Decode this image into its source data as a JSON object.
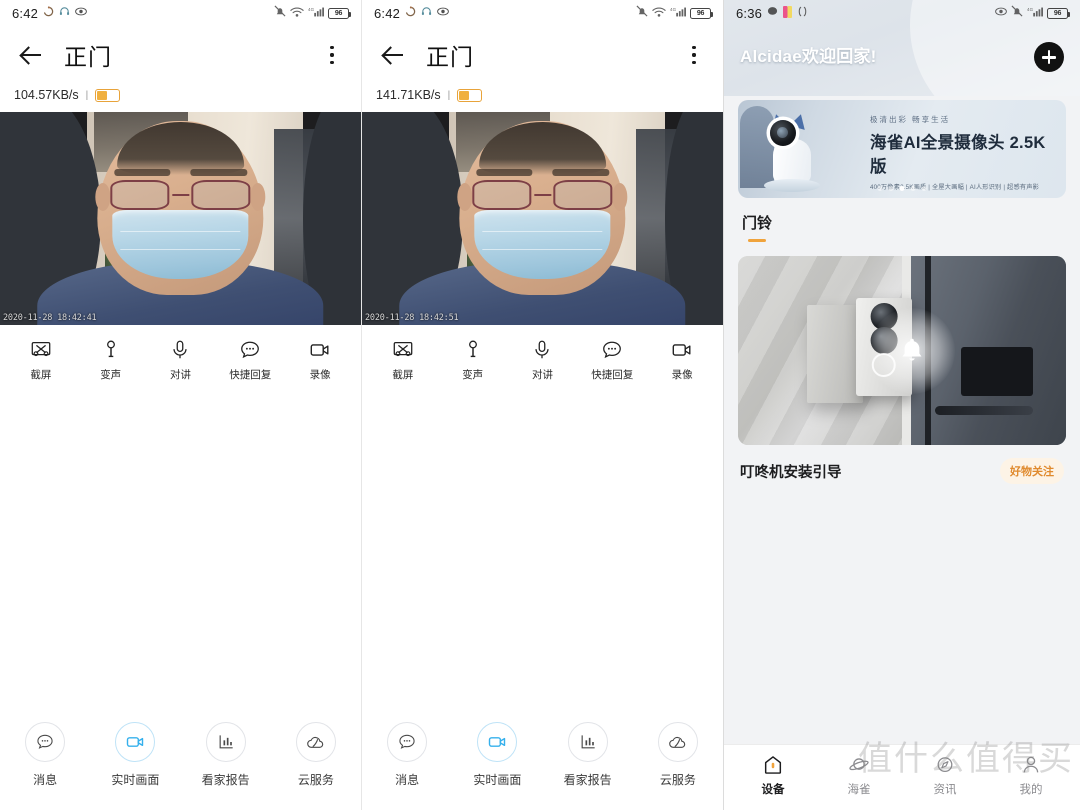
{
  "panels": [
    {
      "status": {
        "time": "6:42",
        "battery": "96",
        "icons": [
          "sync-icon",
          "headphones-icon",
          "eye-icon",
          "bell-off-icon",
          "wifi-icon",
          "signal-icon",
          "battery-icon"
        ]
      },
      "appbar": {
        "title": "正门",
        "back": "back-arrow-icon",
        "menu": "kebab-menu-icon"
      },
      "speed": {
        "value": "104.57KB/s",
        "separator": "|",
        "signal_badge": "signal-pill"
      },
      "video": {
        "timestamp": "2020-11-28 18:42:41"
      },
      "controls": [
        {
          "label": "截屏",
          "icon": "screenshot-icon"
        },
        {
          "label": "变声",
          "icon": "voice-changer-icon"
        },
        {
          "label": "对讲",
          "icon": "microphone-icon"
        },
        {
          "label": "快捷回复",
          "icon": "quick-reply-icon"
        },
        {
          "label": "录像",
          "icon": "record-video-icon"
        }
      ],
      "bottomnav": [
        {
          "label": "消息",
          "icon": "chat-bubble-icon",
          "active": false
        },
        {
          "label": "实时画面",
          "icon": "video-camera-icon",
          "active": true
        },
        {
          "label": "看家报告",
          "icon": "bar-chart-icon",
          "active": false
        },
        {
          "label": "云服务",
          "icon": "cloud-icon",
          "active": false
        }
      ]
    },
    {
      "status": {
        "time": "6:42",
        "battery": "96"
      },
      "appbar": {
        "title": "正门"
      },
      "speed": {
        "value": "141.71KB/s",
        "separator": "|"
      },
      "video": {
        "timestamp": "2020-11-28 18:42:51"
      },
      "controls": [
        {
          "label": "截屏",
          "icon": "screenshot-icon"
        },
        {
          "label": "变声",
          "icon": "voice-changer-icon"
        },
        {
          "label": "对讲",
          "icon": "microphone-icon"
        },
        {
          "label": "快捷回复",
          "icon": "quick-reply-icon"
        },
        {
          "label": "录像",
          "icon": "record-video-icon"
        }
      ],
      "bottomnav": [
        {
          "label": "消息",
          "icon": "chat-bubble-icon",
          "active": false
        },
        {
          "label": "实时画面",
          "icon": "video-camera-icon",
          "active": true
        },
        {
          "label": "看家报告",
          "icon": "bar-chart-icon",
          "active": false
        },
        {
          "label": "云服务",
          "icon": "cloud-icon",
          "active": false
        }
      ]
    }
  ],
  "home": {
    "status": {
      "time": "6:36",
      "battery": "96",
      "icons": [
        "chat-icon",
        "app-icon",
        "brackets-icon",
        "eye-icon",
        "bell-off-icon",
        "signal-icon",
        "battery-icon"
      ]
    },
    "greeting": "Alcidae欢迎回家!",
    "add_button": "plus-icon",
    "banner": {
      "kicker": "极清出彩 畅享生活",
      "title": "海雀AI全景摄像头 2.5K版",
      "subtitle": "400万像素2.5K画质 | 全屋大画幅 | AI人形识别 | 超感有声影",
      "dots_total": 5,
      "dots_active": 3
    },
    "tab": {
      "label": "门铃"
    },
    "card": {
      "title": "叮咚机安装引导",
      "badge": "好物关注",
      "overlay_icon": "bell-icon"
    },
    "bottomnav": [
      {
        "label": "设备",
        "icon": "home-icon",
        "active": true
      },
      {
        "label": "海雀",
        "icon": "planet-icon",
        "active": false
      },
      {
        "label": "资讯",
        "icon": "compass-icon",
        "active": false
      },
      {
        "label": "我的",
        "icon": "person-icon",
        "active": false
      }
    ]
  },
  "watermark": "值什么值得买",
  "colors": {
    "accent_orange": "#f0a33c",
    "accent_blue": "#35b0ec",
    "badge_bg": "#fdf3e6"
  }
}
